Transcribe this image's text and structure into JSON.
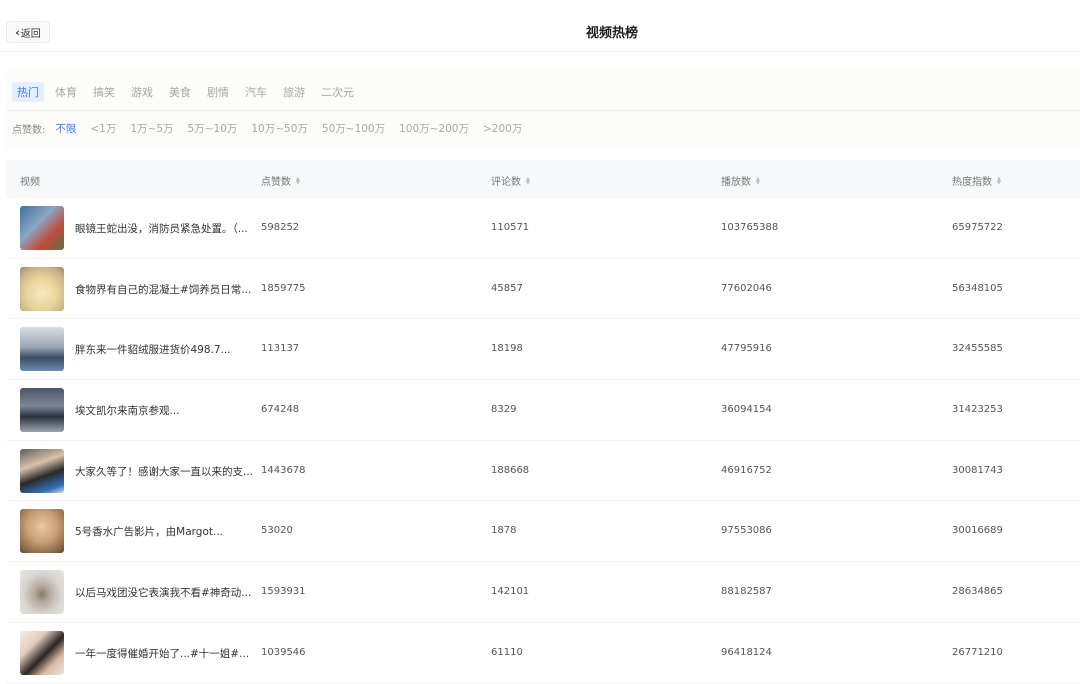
{
  "header": {
    "back_label": "返回",
    "title": "视频热榜"
  },
  "categories": [
    "热门",
    "体育",
    "搞笑",
    "游戏",
    "美食",
    "剧情",
    "汽车",
    "旅游",
    "二次元"
  ],
  "likes_filter": {
    "label": "点赞数:",
    "options": [
      "不限",
      "<1万",
      "1万~5万",
      "5万~10万",
      "10万~50万",
      "50万~100万",
      "100万~200万",
      ">200万"
    ]
  },
  "table": {
    "columns": [
      "视频",
      "点赞数",
      "评论数",
      "播放数",
      "热度指数"
    ],
    "rows": [
      {
        "title": "眼镜王蛇出没，消防员紧急处置。（...",
        "likes": "598252",
        "comments": "110571",
        "plays": "103765388",
        "heat": "65975722"
      },
      {
        "title": "食物界有自己的混凝土#饲养员日常...",
        "likes": "1859775",
        "comments": "45857",
        "plays": "77602046",
        "heat": "56348105"
      },
      {
        "title": "胖东来一件貂绒服进货价498.7...",
        "likes": "113137",
        "comments": "18198",
        "plays": "47795916",
        "heat": "32455585"
      },
      {
        "title": "埃文凯尔来南京参观...",
        "likes": "674248",
        "comments": "8329",
        "plays": "36094154",
        "heat": "31423253"
      },
      {
        "title": "大家久等了！感谢大家一直以来的支...",
        "likes": "1443678",
        "comments": "188668",
        "plays": "46916752",
        "heat": "30081743"
      },
      {
        "title": "5号香水广告影片，由Margot...",
        "likes": "53020",
        "comments": "1878",
        "plays": "97553086",
        "heat": "30016689"
      },
      {
        "title": "以后马戏团没它表演我不看#神奇动...",
        "likes": "1593931",
        "comments": "142101",
        "plays": "88182587",
        "heat": "28634865"
      },
      {
        "title": "一年一度得催婚开始了...#十一姐#...",
        "likes": "1039546",
        "comments": "61110",
        "plays": "96418124",
        "heat": "26771210"
      }
    ]
  }
}
